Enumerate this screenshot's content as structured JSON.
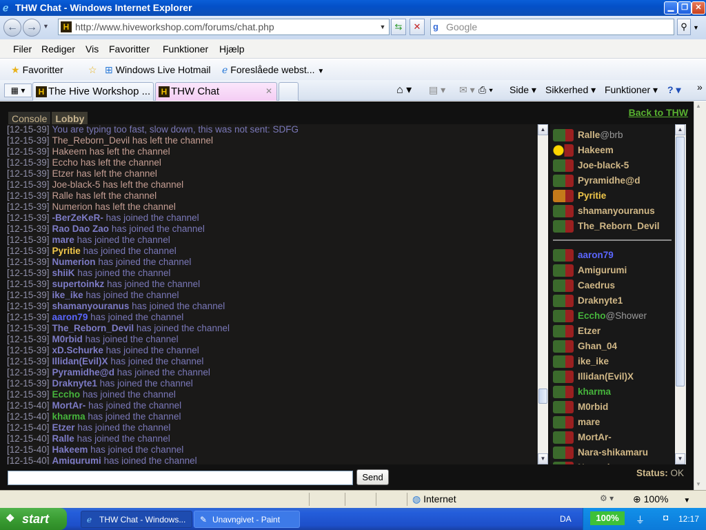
{
  "window": {
    "title": "THW Chat - Windows Internet Explorer"
  },
  "address": {
    "url": "http://www.hiveworkshop.com/forums/chat.php",
    "search_placeholder": "Google"
  },
  "menu": [
    "Filer",
    "Rediger",
    "Vis",
    "Favoritter",
    "Funktioner",
    "Hjælp"
  ],
  "favbar": {
    "favorites": "Favoritter",
    "item1": "Windows Live Hotmail",
    "item2": "Foreslåede webst..."
  },
  "tabs": [
    {
      "label": "The Hive Workshop ..."
    },
    {
      "label": "THW Chat"
    }
  ],
  "commands": {
    "side": "Side",
    "sikkerhed": "Sikkerhed",
    "funktioner": "Funktioner"
  },
  "chat": {
    "console_tab": "Console",
    "lobby_tab": "Lobby",
    "back_link": "Back to THW",
    "send_label": "Send",
    "status_label": "Status:",
    "status_value": "OK",
    "messages": [
      {
        "time": "[12-15-39]",
        "name": "",
        "text": "You are typing too fast, slow down, this was not sent: SDFG",
        "kind": "sys"
      },
      {
        "time": "[12-15-39]",
        "name": "The_Reborn_Devil",
        "text": "has left the channel",
        "kind": "left"
      },
      {
        "time": "[12-15-39]",
        "name": "Hakeem",
        "text": "has left the channel",
        "kind": "left"
      },
      {
        "time": "[12-15-39]",
        "name": "Eccho",
        "text": "has left the channel",
        "kind": "left"
      },
      {
        "time": "[12-15-39]",
        "name": "Etzer",
        "text": "has left the channel",
        "kind": "left"
      },
      {
        "time": "[12-15-39]",
        "name": "Joe-black-5",
        "text": "has left the channel",
        "kind": "left"
      },
      {
        "time": "[12-15-39]",
        "name": "Ralle",
        "text": "has left the channel",
        "kind": "left"
      },
      {
        "time": "[12-15-39]",
        "name": "Numerion",
        "text": "has left the channel",
        "kind": "left"
      },
      {
        "time": "[12-15-39]",
        "name": "-BerZeKeR-",
        "text": "has joined the channel",
        "kind": "join"
      },
      {
        "time": "[12-15-39]",
        "name": "Rao Dao Zao",
        "text": "has joined the channel",
        "kind": "join"
      },
      {
        "time": "[12-15-39]",
        "name": "mare",
        "text": "has joined the channel",
        "kind": "join"
      },
      {
        "time": "[12-15-39]",
        "name": "Pyritie",
        "text": "has joined the channel",
        "kind": "join-yel"
      },
      {
        "time": "[12-15-39]",
        "name": "Numerion",
        "text": "has joined the channel",
        "kind": "join"
      },
      {
        "time": "[12-15-39]",
        "name": "shiiK",
        "text": "has joined the channel",
        "kind": "join"
      },
      {
        "time": "[12-15-39]",
        "name": "supertoinkz",
        "text": "has joined the channel",
        "kind": "join"
      },
      {
        "time": "[12-15-39]",
        "name": "ike_ike",
        "text": "has joined the channel",
        "kind": "join"
      },
      {
        "time": "[12-15-39]",
        "name": "shamanyouranus",
        "text": "has joined the channel",
        "kind": "join"
      },
      {
        "time": "[12-15-39]",
        "name": "aaron79",
        "text": "has joined the channel",
        "kind": "join-blue"
      },
      {
        "time": "[12-15-39]",
        "name": "The_Reborn_Devil",
        "text": "has joined the channel",
        "kind": "join"
      },
      {
        "time": "[12-15-39]",
        "name": "M0rbid",
        "text": "has joined the channel",
        "kind": "join"
      },
      {
        "time": "[12-15-39]",
        "name": "xD.Schurke",
        "text": "has joined the channel",
        "kind": "join"
      },
      {
        "time": "[12-15-39]",
        "name": "Illidan(Evil)X",
        "text": "has joined the channel",
        "kind": "join"
      },
      {
        "time": "[12-15-39]",
        "name": "Pyramidhe@d",
        "text": "has joined the channel",
        "kind": "join"
      },
      {
        "time": "[12-15-39]",
        "name": "Draknyte1",
        "text": "has joined the channel",
        "kind": "join"
      },
      {
        "time": "[12-15-39]",
        "name": "Eccho",
        "text": "has joined the channel",
        "kind": "join-green"
      },
      {
        "time": "[12-15-40]",
        "name": "MortAr-",
        "text": "has joined the channel",
        "kind": "join"
      },
      {
        "time": "[12-15-40]",
        "name": "kharma",
        "text": "has joined the channel",
        "kind": "join-green"
      },
      {
        "time": "[12-15-40]",
        "name": "Etzer",
        "text": "has joined the channel",
        "kind": "join"
      },
      {
        "time": "[12-15-40]",
        "name": "Ralle",
        "text": "has joined the channel",
        "kind": "join"
      },
      {
        "time": "[12-15-40]",
        "name": "Hakeem",
        "text": "has joined the channel",
        "kind": "join"
      },
      {
        "time": "[12-15-40]",
        "name": "Amigurumi",
        "text": "has joined the channel",
        "kind": "join"
      }
    ],
    "users_top": [
      {
        "name": "Ralle",
        "status": "@brb",
        "avatar": "blue",
        "color": ""
      },
      {
        "name": "Hakeem",
        "status": "",
        "avatar": "smiley",
        "color": ""
      },
      {
        "name": "Joe-black-5",
        "status": "",
        "avatar": "orc",
        "color": ""
      },
      {
        "name": "Pyramidhe@d",
        "status": "",
        "avatar": "orc",
        "color": ""
      },
      {
        "name": "Pyritie",
        "status": "",
        "avatar": "fire",
        "color": "yel"
      },
      {
        "name": "shamanyouranus",
        "status": "",
        "avatar": "orc",
        "color": ""
      },
      {
        "name": "The_Reborn_Devil",
        "status": "",
        "avatar": "orc",
        "color": ""
      }
    ],
    "users_bottom": [
      {
        "name": "aaron79",
        "status": "",
        "avatar": "orc",
        "color": "blue"
      },
      {
        "name": "Amigurumi",
        "status": "",
        "avatar": "orc",
        "color": ""
      },
      {
        "name": "Caedrus",
        "status": "",
        "avatar": "orc",
        "color": ""
      },
      {
        "name": "Draknyte1",
        "status": "",
        "avatar": "orc",
        "color": ""
      },
      {
        "name": "Eccho",
        "status": "@Shower",
        "avatar": "orc",
        "color": "green"
      },
      {
        "name": "Etzer",
        "status": "",
        "avatar": "orc",
        "color": ""
      },
      {
        "name": "Ghan_04",
        "status": "",
        "avatar": "orc",
        "color": ""
      },
      {
        "name": "ike_ike",
        "status": "",
        "avatar": "orc",
        "color": ""
      },
      {
        "name": "Illidan(Evil)X",
        "status": "",
        "avatar": "orc",
        "color": ""
      },
      {
        "name": "kharma",
        "status": "",
        "avatar": "orc",
        "color": "green"
      },
      {
        "name": "M0rbid",
        "status": "",
        "avatar": "orc",
        "color": ""
      },
      {
        "name": "mare",
        "status": "",
        "avatar": "orc",
        "color": ""
      },
      {
        "name": "MortAr-",
        "status": "",
        "avatar": "orc",
        "color": ""
      },
      {
        "name": "Nara-shikamaru",
        "status": "",
        "avatar": "orc",
        "color": ""
      },
      {
        "name": "Numerion",
        "status": "",
        "avatar": "orc",
        "color": ""
      }
    ]
  },
  "iestatus": {
    "zone": "Internet",
    "zoom": "100%"
  },
  "taskbar": {
    "start": "start",
    "task1": "THW Chat - Windows...",
    "task2": "Unavngivet - Paint",
    "lang": "DA",
    "battery": "100%",
    "clock": "12:17"
  }
}
